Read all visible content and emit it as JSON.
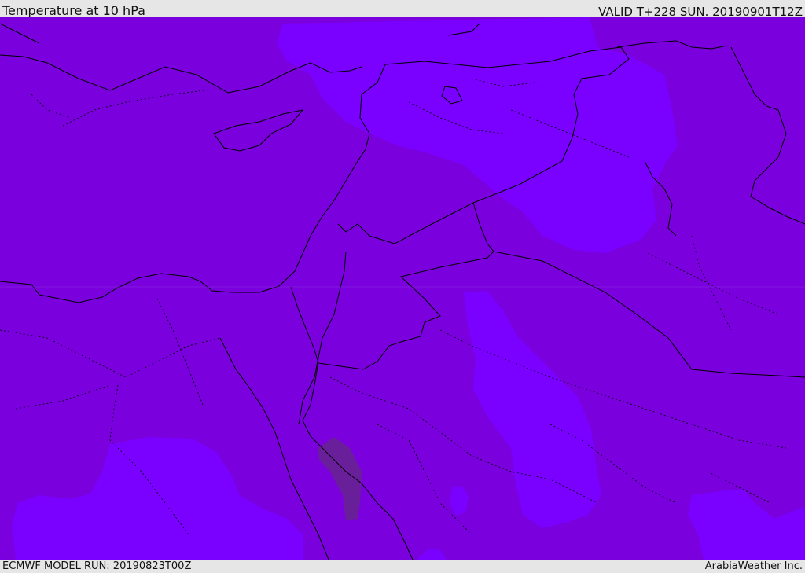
{
  "header": {
    "title": "Temperature at 10 hPa",
    "valid_time": "VALID T+228 SUN. 20190901T12Z"
  },
  "footer": {
    "model_run": "ECMWF MODEL RUN: 20190823T00Z",
    "credit": "ArabiaWeather Inc."
  },
  "colors": {
    "base_fill": "#7a00dd",
    "warm_patch": "#7a00ff",
    "mid_patch": "#7200bb",
    "cool_patch": "#6a1f9a",
    "border": "#000000",
    "frame": "#e6e6e6"
  }
}
